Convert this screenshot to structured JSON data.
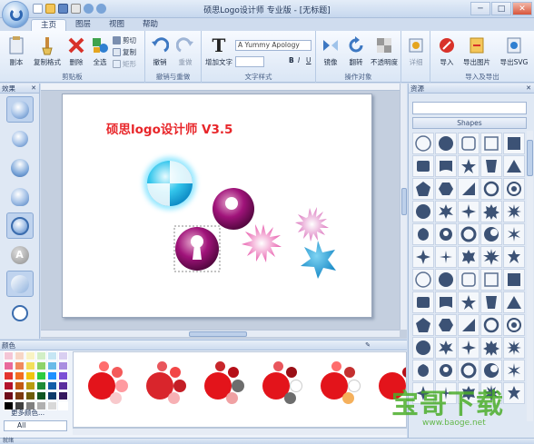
{
  "window": {
    "title": "硕思Logo设计师 专业版 - [无标题]",
    "min": "─",
    "max": "□",
    "close": "✕"
  },
  "tabs": [
    "主页",
    "图层",
    "视图",
    "帮助"
  ],
  "ribbon": {
    "clipboard": {
      "paste": "副本",
      "format": "复制格式",
      "delete": "删除",
      "select_all": "全选",
      "cut": "剪切",
      "copy": "复制",
      "rect": "矩形",
      "label": "剪贴板"
    },
    "undo": {
      "undo": "撤销",
      "redo": "重做",
      "label": "撤销与重做"
    },
    "text": {
      "add_text": "增加文字",
      "font": "A Yummy Apology",
      "bold": "B",
      "italic": "I",
      "underline": "U",
      "label": "文字样式"
    },
    "ops": {
      "mirror": "镜像",
      "rotate": "翻转",
      "opacity": "不透明度",
      "label": "操作对象"
    },
    "detail": {
      "label": "详细"
    },
    "io": {
      "import": "导入",
      "export_img": "导出图片",
      "export_svg": "导出SVG",
      "label": "导入及导出"
    }
  },
  "panels": {
    "effects": "效果",
    "resources": "资源",
    "colors": "颜色",
    "shapes_dropdown": "Shapes",
    "more_colors": "更多颜色...",
    "filter": "All"
  },
  "canvas": {
    "title_text": "硕思logo设计师  V3.5"
  },
  "status": {
    "text": "就绪"
  },
  "watermark": {
    "text": "宝哥下载",
    "url": "www.baoge.net"
  },
  "colors": {
    "palette": [
      "#f4c6d6",
      "#f7d6c6",
      "#f9f3c4",
      "#d2efc6",
      "#c6e6f4",
      "#d9cff1",
      "#e86a9c",
      "#f08a5e",
      "#f3df5c",
      "#8ed36a",
      "#6bbbe8",
      "#a98ee0",
      "#e3342f",
      "#f26d21",
      "#f1c40f",
      "#2ecc40",
      "#1e90ff",
      "#7b4fd6",
      "#b3122c",
      "#c25a12",
      "#b89b10",
      "#1e8b37",
      "#125ea8",
      "#5a2e9e",
      "#6e0d1b",
      "#7b3a10",
      "#6d5c0a",
      "#0f5521",
      "#0c3a6a",
      "#34175e",
      "#000000",
      "#404040",
      "#808080",
      "#b0b0b0",
      "#d8d8d8",
      "#ffffff"
    ]
  }
}
